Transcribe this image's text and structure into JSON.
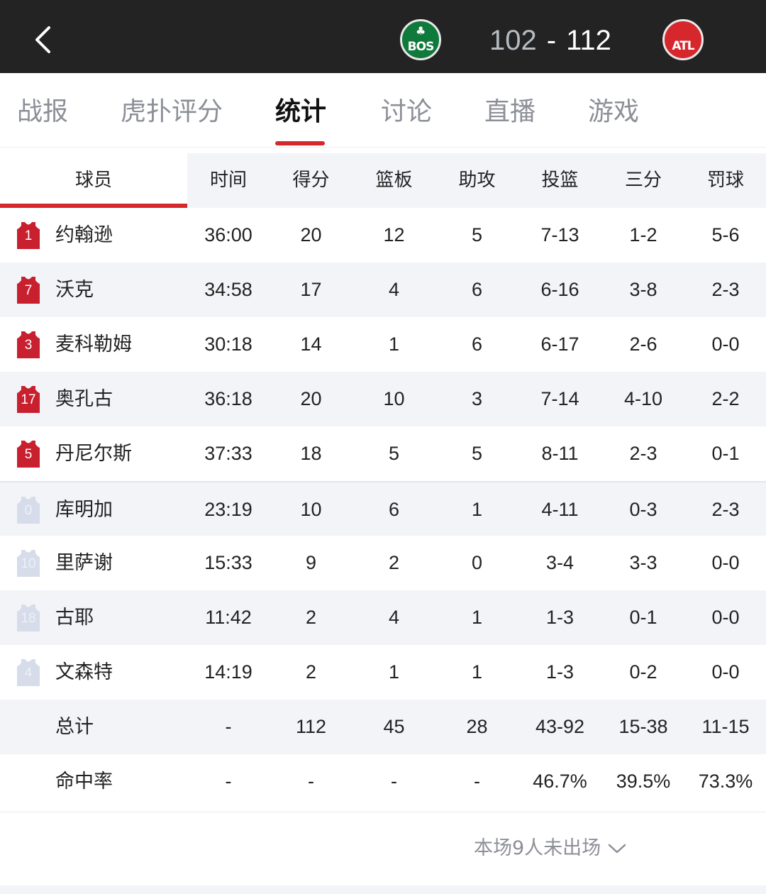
{
  "header": {
    "home_team": "BOS",
    "away_team": "ATL",
    "home_score": "102",
    "score_separator": "-",
    "away_score": "112",
    "home_color": "#0f7a3c",
    "away_color": "#d6272d",
    "back_icon": "chevron-left-icon"
  },
  "tabs": [
    {
      "label": "战报"
    },
    {
      "label": "虎扑评分"
    },
    {
      "label": "统计",
      "active": true
    },
    {
      "label": "讨论"
    },
    {
      "label": "直播"
    },
    {
      "label": "游戏"
    }
  ],
  "table": {
    "columns": [
      "球员",
      "时间",
      "得分",
      "篮板",
      "助攻",
      "投篮",
      "三分",
      "罚球"
    ],
    "starters": [
      {
        "number": "1",
        "name": "约翰逊",
        "time": "36:00",
        "pts": "20",
        "reb": "12",
        "ast": "5",
        "fg": "7-13",
        "tp": "1-2",
        "ft": "5-6"
      },
      {
        "number": "7",
        "name": "沃克",
        "time": "34:58",
        "pts": "17",
        "reb": "4",
        "ast": "6",
        "fg": "6-16",
        "tp": "3-8",
        "ft": "2-3"
      },
      {
        "number": "3",
        "name": "麦科勒姆",
        "time": "30:18",
        "pts": "14",
        "reb": "1",
        "ast": "6",
        "fg": "6-17",
        "tp": "2-6",
        "ft": "0-0"
      },
      {
        "number": "17",
        "name": "奥孔古",
        "time": "36:18",
        "pts": "20",
        "reb": "10",
        "ast": "3",
        "fg": "7-14",
        "tp": "4-10",
        "ft": "2-2"
      },
      {
        "number": "5",
        "name": "丹尼尔斯",
        "time": "37:33",
        "pts": "18",
        "reb": "5",
        "ast": "5",
        "fg": "8-11",
        "tp": "2-3",
        "ft": "0-1"
      }
    ],
    "bench": [
      {
        "number": "0",
        "name": "库明加",
        "time": "23:19",
        "pts": "10",
        "reb": "6",
        "ast": "1",
        "fg": "4-11",
        "tp": "0-3",
        "ft": "2-3"
      },
      {
        "number": "10",
        "name": "里萨谢",
        "time": "15:33",
        "pts": "9",
        "reb": "2",
        "ast": "0",
        "fg": "3-4",
        "tp": "3-3",
        "ft": "0-0"
      },
      {
        "number": "18",
        "name": "古耶",
        "time": "11:42",
        "pts": "2",
        "reb": "4",
        "ast": "1",
        "fg": "1-3",
        "tp": "0-1",
        "ft": "0-0"
      },
      {
        "number": "4",
        "name": "文森特",
        "time": "14:19",
        "pts": "2",
        "reb": "1",
        "ast": "1",
        "fg": "1-3",
        "tp": "0-2",
        "ft": "0-0"
      }
    ],
    "totals": {
      "label": "总计",
      "time": "-",
      "pts": "112",
      "reb": "45",
      "ast": "28",
      "fg": "43-92",
      "tp": "15-38",
      "ft": "11-15"
    },
    "percentages": {
      "label": "命中率",
      "time": "-",
      "pts": "-",
      "reb": "-",
      "ast": "-",
      "fg": "46.7%",
      "tp": "39.5%",
      "ft": "73.3%"
    },
    "starter_jersey_color": "#c8202e",
    "bench_jersey_color": "#d6dcea"
  },
  "footer": {
    "dnp_label": "本场9人未出场",
    "dnp_icon": "chevron-down-icon"
  }
}
